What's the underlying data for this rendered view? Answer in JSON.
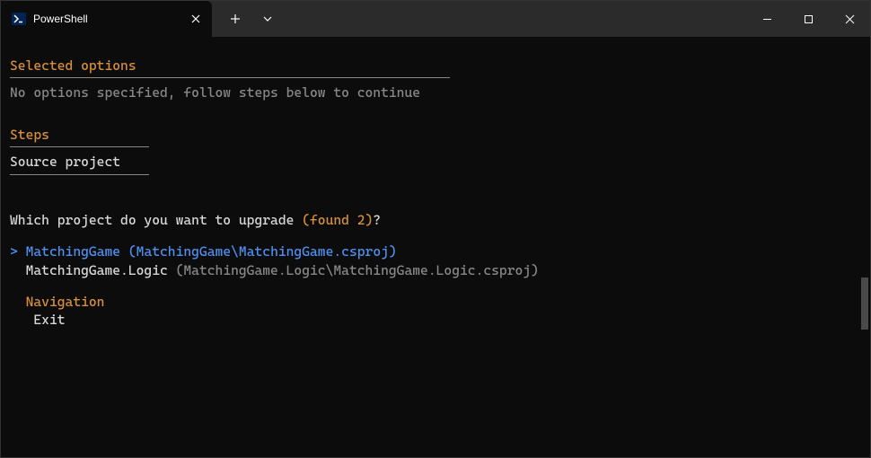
{
  "tab": {
    "title": "PowerShell"
  },
  "sections": {
    "selected_options_heading": "Selected options",
    "selected_options_body": "No options specified, follow steps below to continue",
    "steps_heading": "Steps",
    "steps_item": "Source project"
  },
  "prompt": {
    "question_prefix": "Which project do you want to upgrade ",
    "found_text": "(found 2)",
    "question_suffix": "?",
    "caret": ">",
    "option1_name": "MatchingGame",
    "option1_path": "(MatchingGame\\MatchingGame.csproj)",
    "option2_name": "MatchingGame.Logic",
    "option2_path": "(MatchingGame.Logic\\MatchingGame.Logic.csproj)",
    "nav_heading": "Navigation",
    "nav_exit": "Exit"
  }
}
